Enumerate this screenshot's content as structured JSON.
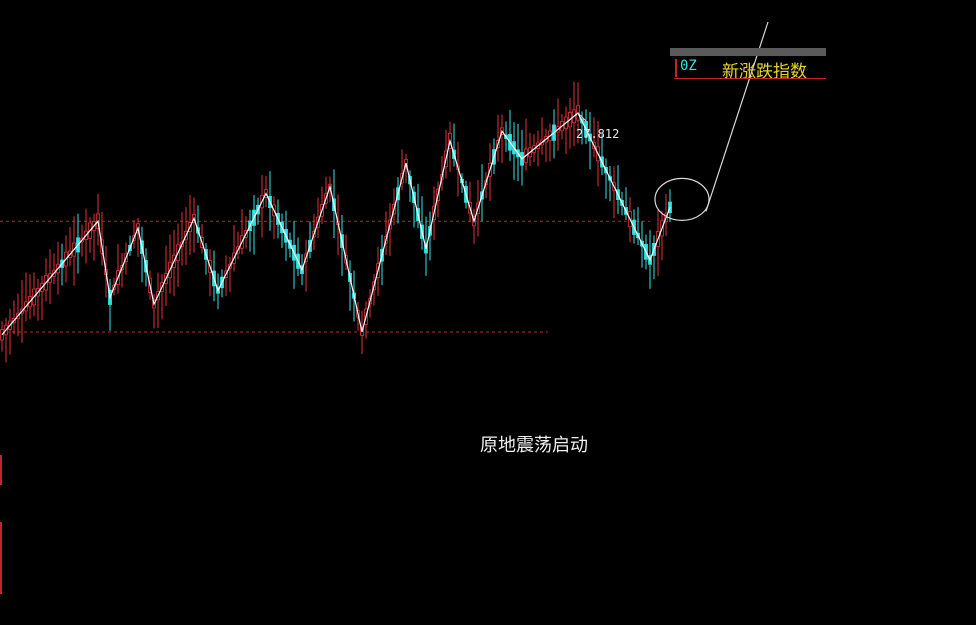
{
  "legend": {
    "code": "0Z",
    "name": "新涨跌指数"
  },
  "caption": "原地震荡启动",
  "chart_data": {
    "type": "candlestick",
    "peak_label": "27.812",
    "colors": {
      "up": "#e0343a",
      "down": "#33e3e3",
      "zigzag": "#ffffff",
      "ref_line": "#c0262b",
      "arrow": "#d8d8d8"
    },
    "upper_reference": 20.0,
    "lower_reference": 12.0,
    "zigzag_points": [
      {
        "i": 0,
        "v": 11.8
      },
      {
        "i": 24,
        "v": 20.0
      },
      {
        "i": 27,
        "v": 14.5
      },
      {
        "i": 34,
        "v": 19.5
      },
      {
        "i": 38,
        "v": 14.0
      },
      {
        "i": 48,
        "v": 20.2
      },
      {
        "i": 54,
        "v": 15.0
      },
      {
        "i": 66,
        "v": 22.0
      },
      {
        "i": 75,
        "v": 16.5
      },
      {
        "i": 82,
        "v": 22.5
      },
      {
        "i": 90,
        "v": 12.0
      },
      {
        "i": 101,
        "v": 24.2
      },
      {
        "i": 106,
        "v": 18.0
      },
      {
        "i": 112,
        "v": 25.8
      },
      {
        "i": 118,
        "v": 20.0
      },
      {
        "i": 125,
        "v": 26.5
      },
      {
        "i": 130,
        "v": 24.5
      },
      {
        "i": 144,
        "v": 27.812
      },
      {
        "i": 162,
        "v": 17.2
      },
      {
        "i": 167,
        "v": 21.0
      }
    ]
  }
}
